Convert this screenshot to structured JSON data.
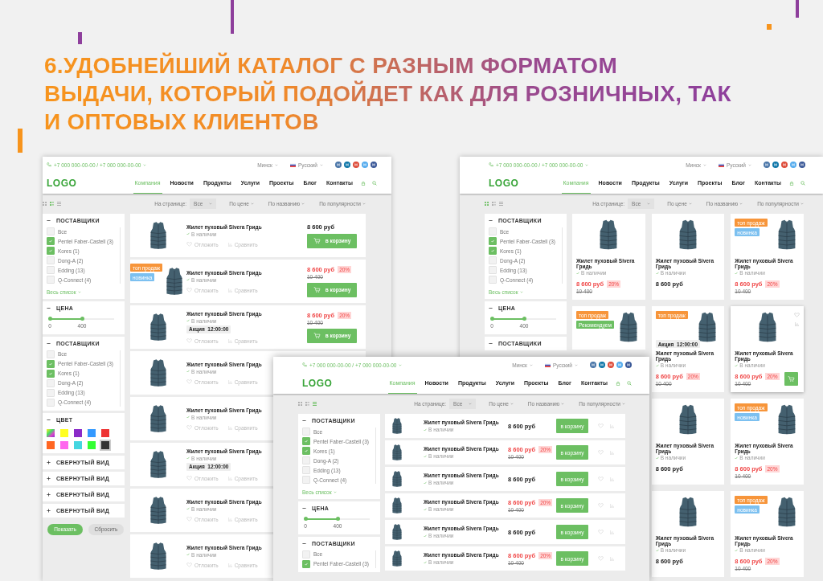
{
  "headline": [
    "6.УДОБНЕЙШИЙ КАТАЛОГ С РАЗНЫМ ФОРМАТОМ",
    "ВЫДАЧИ, КОТОРЫЙ ПОДОЙДЕТ КАК ДЛЯ РОЗНИЧНЫХ, ТАК",
    "И ОПТОВЫХ КЛИЕНТОВ"
  ],
  "screens": [
    {
      "kind": "list",
      "header": {
        "phones": "+7 000 000-00-00  /  +7 000 000-00-00",
        "city": "Минск",
        "language": "Русский",
        "logo": "LOGO",
        "nav": [
          {
            "label": "Компания",
            "selected": true
          },
          {
            "label": "Новости",
            "selected": false
          },
          {
            "label": "Продукты",
            "selected": false
          },
          {
            "label": "Услуги",
            "selected": false
          },
          {
            "label": "Проекты",
            "selected": false
          },
          {
            "label": "Блог",
            "selected": false
          },
          {
            "label": "Контакты",
            "selected": false
          }
        ]
      },
      "toolbar": {
        "views": [
          {
            "kind": "grid",
            "selected": false
          },
          {
            "kind": "list",
            "selected": true
          },
          {
            "kind": "table",
            "selected": false
          }
        ],
        "per_page_label": "На странице:",
        "per_page": "Все",
        "sorts": [
          "По цене",
          "По названию",
          "По популярности"
        ]
      },
      "filters": [
        {
          "kind": "checklist",
          "title": "ПОСТАВЩИКИ",
          "expanded": true,
          "options": [
            {
              "label": "Все",
              "checked": false
            },
            {
              "label": "Pentel Faber-Castell (3)",
              "checked": true
            },
            {
              "label": "Kores (1)",
              "checked": true
            },
            {
              "label": "Dong-A (2)",
              "checked": false
            },
            {
              "label": "Edding (13)",
              "checked": false
            },
            {
              "label": "Q-Connect (4)",
              "checked": false
            }
          ],
          "more": "Весь список"
        },
        {
          "kind": "range",
          "title": "ЦЕНА",
          "expanded": true,
          "min": "0",
          "max": "400",
          "level": 0.5
        },
        {
          "kind": "checklist",
          "title": "ПОСТАВЩИКИ",
          "expanded": true,
          "options": [
            {
              "label": "Все",
              "checked": false
            },
            {
              "label": "Pentel Faber-Castell (3)",
              "checked": true
            },
            {
              "label": "Kores (1)",
              "checked": true
            },
            {
              "label": "Dong-A (2)",
              "checked": false
            },
            {
              "label": "Edding (13)",
              "checked": false
            },
            {
              "label": "Q-Connect (4)",
              "checked": false
            }
          ]
        },
        {
          "kind": "colors",
          "title": "ЦВЕТ",
          "expanded": true,
          "swatches": [
            {
              "kind": "gradient",
              "selected": false
            },
            {
              "kind": "solid",
              "color": "#ffff22",
              "selected": false
            },
            {
              "kind": "solid",
              "color": "#8a2bc8",
              "selected": false
            },
            {
              "kind": "solid",
              "color": "#3399ff",
              "selected": false
            },
            {
              "kind": "solid",
              "color": "#ee3333",
              "selected": false
            },
            {
              "kind": "solid",
              "color": "#ff6622",
              "selected": false
            },
            {
              "kind": "solid",
              "color": "#ff66ee",
              "selected": false
            },
            {
              "kind": "solid",
              "color": "#44d6e0",
              "selected": false
            },
            {
              "kind": "solid",
              "color": "#33ff33",
              "selected": false
            },
            {
              "kind": "solid",
              "color": "#333333",
              "selected": true
            }
          ]
        },
        {
          "title": "СВЕРНУТЫЙ ВИД",
          "expanded": false
        },
        {
          "title": "СВЕРНУТЫЙ ВИД",
          "expanded": false
        },
        {
          "title": "СВЕРНУТЫЙ ВИД",
          "expanded": false
        },
        {
          "title": "СВЕРНУТЫЙ ВИД",
          "expanded": false
        }
      ],
      "filter_actions": [
        {
          "label": "Показать",
          "disabled": false
        },
        {
          "label": "Сбросить",
          "disabled": true
        }
      ],
      "products": [
        {
          "title": "Жилет пуховый  Sivera Гридь",
          "stock": "В наличии",
          "favorite": "Отложить",
          "compare": "Сравнить",
          "price": "8 600 руб",
          "sale": false,
          "cart": "в корзину"
        },
        {
          "badges": [
            {
              "label": "топ продаж",
              "color": "#f7953a"
            },
            {
              "label": "новинка",
              "color": "#7cc0f0"
            }
          ],
          "title": "Жилет пуховый  Sivera Гридь",
          "stock": "В наличии",
          "favorite": "Отложить",
          "compare": "Сравнить",
          "price": "8 600 руб",
          "sale": true,
          "discount": "20%",
          "old_price": "10 400",
          "cart": "в корзину"
        },
        {
          "title": "Жилет пуховый  Sivera Гридь",
          "stock": "В наличии",
          "promo": "Акция  12:00:00",
          "favorite": "Отложить",
          "compare": "Сравнить",
          "price": "8 600 руб",
          "sale": true,
          "discount": "20%",
          "old_price": "10 400",
          "cart": "в корзину"
        },
        {
          "title": "Жилет пуховый  Sivera Гридь",
          "stock": "В наличии",
          "favorite": "Отложить",
          "compare": "Сравнить"
        },
        {
          "title": "Жилет пуховый  Sivera Гридь",
          "stock": "В наличии",
          "favorite": "Отложить",
          "compare": "Сравнить"
        },
        {
          "title": "Жилет пуховый  Sivera Гридь",
          "stock": "В наличии",
          "promo": "Акция  12:00:00",
          "favorite": "Отложить",
          "compare": "Сравнить"
        },
        {
          "title": "Жилет пуховый  Sivera Гридь",
          "stock": "В наличии",
          "favorite": "Отложить",
          "compare": "Сравнить"
        },
        {
          "title": "Жилет пуховый  Sivera Гридь",
          "stock": "В наличии",
          "favorite": "Отложить",
          "compare": "Сравнить"
        }
      ]
    },
    {
      "kind": "grid",
      "header": {
        "phones": "+7 000 000-00-00  /  +7 000 000-00-00",
        "city": "Минск",
        "language": "Русский",
        "logo": "LOGO",
        "nav": [
          {
            "label": "Компания",
            "selected": true
          },
          {
            "label": "Новости",
            "selected": false
          },
          {
            "label": "Продукты",
            "selected": false
          },
          {
            "label": "Услуги",
            "selected": false
          },
          {
            "label": "Проекты",
            "selected": false
          },
          {
            "label": "Блог",
            "selected": false
          },
          {
            "label": "Контакты",
            "selected": false
          }
        ]
      },
      "toolbar": {
        "views": [
          {
            "kind": "grid",
            "selected": true
          },
          {
            "kind": "list",
            "selected": false
          },
          {
            "kind": "table",
            "selected": false
          }
        ],
        "per_page_label": "На странице:",
        "per_page": "Все",
        "sorts": [
          "По цене",
          "По названию",
          "По популярности"
        ]
      },
      "filters": [
        {
          "kind": "checklist",
          "title": "ПОСТАВЩИКИ",
          "expanded": true,
          "options": [
            {
              "label": "Все",
              "checked": false
            },
            {
              "label": "Pentel Faber-Castell (3)",
              "checked": true
            },
            {
              "label": "Kores (1)",
              "checked": true
            },
            {
              "label": "Dong-A (2)",
              "checked": false
            },
            {
              "label": "Edding (13)",
              "checked": false
            },
            {
              "label": "Q-Connect (4)",
              "checked": false
            }
          ],
          "more": "Весь список"
        },
        {
          "kind": "range",
          "title": "ЦЕНА",
          "expanded": true,
          "min": "0",
          "max": "400",
          "level": 0.5
        },
        {
          "kind": "checklist",
          "title": "ПОСТАВЩИКИ",
          "expanded": true
        }
      ],
      "product_columns": [
        [
          {
            "title": "Жилет пуховый  Sivera Гридь",
            "stock": "В наличии",
            "price": "8 600 руб",
            "sale": true,
            "discount": "20%",
            "old_price": "10 400",
            "hovered": false
          },
          {
            "badges": [
              {
                "label": "топ продаж",
                "color": "#f7953a"
              },
              {
                "label": "Рекомендуем",
                "color": "#6cbf62"
              }
            ],
            "hovered": false
          }
        ],
        [
          {
            "title": "Жилет пуховый  Sivera Гридь",
            "stock": "В наличии",
            "price": "8 600 руб",
            "sale": false,
            "hovered": false
          },
          {
            "badges": [
              {
                "label": "топ продаж",
                "color": "#f7953a"
              }
            ],
            "promo": "Акция  12:00:00",
            "title": "Жилет пуховый  Sivera Гридь",
            "stock": "В наличии",
            "price": "8 600 руб",
            "sale": true,
            "discount": "20%",
            "old_price": "10 400",
            "hovered": false
          },
          {
            "title": "Жилет пуховый  Sivera Гридь",
            "stock": "В наличии",
            "price": "8 600 руб",
            "sale": false,
            "hovered": false
          },
          {
            "title": "Жилет пуховый  Sivera Гридь",
            "stock": "В наличии",
            "price": "8 600 руб",
            "sale": false,
            "hovered": false
          }
        ],
        [
          {
            "badges": [
              {
                "label": "топ продаж",
                "color": "#f7953a"
              },
              {
                "label": "новинка",
                "color": "#7cc0f0"
              }
            ],
            "title": "Жилет пуховый  Sivera Гридь",
            "stock": "В наличии",
            "price": "8 600 руб",
            "sale": true,
            "discount": "20%",
            "old_price": "10 400",
            "hovered": false
          },
          {
            "title": "Жилет пуховый  Sivera Гридь",
            "stock": "В наличии",
            "price": "8 600 руб",
            "sale": true,
            "discount": "20%",
            "old_price": "10 400",
            "hovered": true
          },
          {
            "badges": [
              {
                "label": "топ продаж",
                "color": "#f7953a"
              },
              {
                "label": "новинка",
                "color": "#7cc0f0"
              }
            ],
            "title": "Жилет пуховый  Sivera Гридь",
            "stock": "В наличии",
            "price": "8 600 руб",
            "sale": true,
            "discount": "20%",
            "old_price": "10 400",
            "hovered": false
          },
          {
            "badges": [
              {
                "label": "топ продаж",
                "color": "#f7953a"
              },
              {
                "label": "новинка",
                "color": "#7cc0f0"
              }
            ],
            "title": "Жилет пуховый  Sivera Гридь",
            "stock": "В наличии",
            "price": "8 600 руб",
            "sale": true,
            "discount": "20%",
            "old_price": "10 400",
            "hovered": false
          }
        ]
      ]
    },
    {
      "kind": "table",
      "header": {
        "phones": "+7 000 000-00-00  /  +7 000 000-00-00",
        "city": "Минск",
        "language": "Русский",
        "logo": "LOGO",
        "nav": [
          {
            "label": "Компания",
            "selected": true
          },
          {
            "label": "Новости",
            "selected": false
          },
          {
            "label": "Продукты",
            "selected": false
          },
          {
            "label": "Услуги",
            "selected": false
          },
          {
            "label": "Проекты",
            "selected": false
          },
          {
            "label": "Блог",
            "selected": false
          },
          {
            "label": "Контакты",
            "selected": false
          }
        ]
      },
      "toolbar": {
        "views": [
          {
            "kind": "grid",
            "selected": false
          },
          {
            "kind": "list",
            "selected": false
          },
          {
            "kind": "table",
            "selected": true
          }
        ],
        "per_page_label": "На странице:",
        "per_page": "Все",
        "sorts": [
          "По цене",
          "По названию",
          "По популярности"
        ]
      },
      "filters": [
        {
          "kind": "checklist",
          "title": "ПОСТАВЩИКИ",
          "expanded": true,
          "options": [
            {
              "label": "Все",
              "checked": false
            },
            {
              "label": "Pentel Faber-Castell (3)",
              "checked": true
            },
            {
              "label": "Kores (1)",
              "checked": true
            },
            {
              "label": "Dong-A (2)",
              "checked": false
            },
            {
              "label": "Edding (13)",
              "checked": false
            },
            {
              "label": "Q-Connect (4)",
              "checked": false
            }
          ],
          "more": "Весь список"
        },
        {
          "kind": "range",
          "title": "ЦЕНА",
          "expanded": true,
          "min": "0",
          "max": "400",
          "level": 0.5
        },
        {
          "kind": "checklist",
          "title": "ПОСТАВЩИКИ",
          "expanded": true,
          "options": [
            {
              "label": "Все",
              "checked": false
            },
            {
              "label": "Pentel Faber-Castell (3)",
              "checked": true
            }
          ]
        }
      ],
      "products": [
        {
          "title": "Жилет пуховый  Sivera Гридь",
          "stock": "В наличии",
          "price": "8 600 руб",
          "sale": false,
          "cart": "в корзину"
        },
        {
          "title": "Жилет пуховый  Sivera Гридь",
          "stock": "В наличии",
          "price": "8 600 руб",
          "sale": true,
          "discount": "20%",
          "old_price": "10 400",
          "cart": "в корзину"
        },
        {
          "title": "Жилет пуховый  Sivera Гридь",
          "stock": "В наличии",
          "price": "8 600 руб",
          "sale": false,
          "cart": "в корзину"
        },
        {
          "title": "Жилет пуховый  Sivera Гридь",
          "stock": "В наличии",
          "price": "8 600 руб",
          "sale": true,
          "discount": "20%",
          "old_price": "10 400",
          "cart": "в корзину"
        },
        {
          "title": "Жилет пуховый  Sivera Гридь",
          "stock": "В наличии",
          "price": "8 600 руб",
          "sale": false,
          "cart": "в корзину"
        },
        {
          "title": "Жилет пуховый  Sivera Гридь",
          "stock": "В наличии",
          "price": "8 600 руб",
          "sale": true,
          "discount": "20%",
          "old_price": "10 400",
          "cart": "в корзину"
        }
      ]
    }
  ]
}
